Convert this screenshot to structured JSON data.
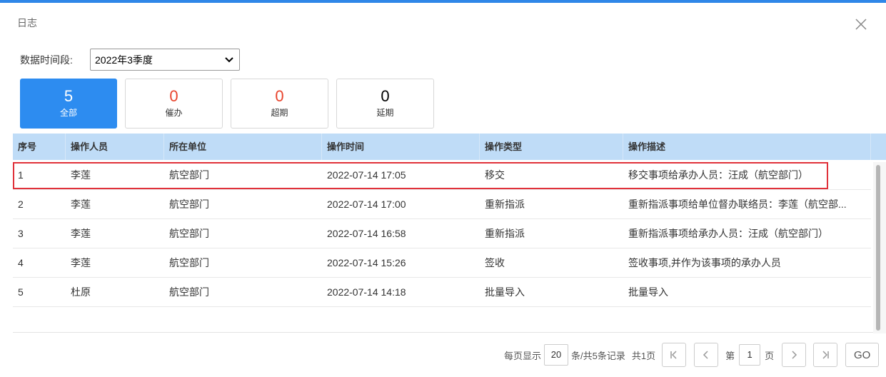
{
  "dialog": {
    "title": "日志"
  },
  "filter": {
    "label": "数据时间段:",
    "selected": "2022年3季度"
  },
  "stats": [
    {
      "count": "5",
      "label": "全部",
      "active": true
    },
    {
      "count": "0",
      "label": "催办",
      "color": "#e8432c"
    },
    {
      "count": "0",
      "label": "超期",
      "color": "#e8432c"
    },
    {
      "count": "0",
      "label": "延期"
    }
  ],
  "table": {
    "columns": [
      "序号",
      "操作人员",
      "所在单位",
      "操作时间",
      "操作类型",
      "操作描述"
    ],
    "rows": [
      [
        "1",
        "李莲",
        "航空部门",
        "2022-07-14 17:05",
        "移交",
        "移交事项给承办人员：汪成（航空部门）"
      ],
      [
        "2",
        "李莲",
        "航空部门",
        "2022-07-14 17:00",
        "重新指派",
        "重新指派事项给单位督办联络员：李莲（航空部..."
      ],
      [
        "3",
        "李莲",
        "航空部门",
        "2022-07-14 16:58",
        "重新指派",
        "重新指派事项给承办人员：汪成（航空部门）"
      ],
      [
        "4",
        "李莲",
        "航空部门",
        "2022-07-14 15:26",
        "签收",
        "签收事项,并作为该事项的承办人员"
      ],
      [
        "5",
        "杜原",
        "航空部门",
        "2022-07-14 14:18",
        "批量导入",
        "批量导入"
      ]
    ],
    "highlight_color": "#e0313a",
    "header_bg": "#bfdcf7"
  },
  "pager": {
    "per_page_label": "每页显示",
    "per_page": "20",
    "records_label": "条/共5条记录",
    "total_pages_label": "共1页",
    "page_prefix": "第",
    "page": "1",
    "page_suffix": "页",
    "go_label": "GO"
  },
  "colors": {
    "accent": "#2d8cf0",
    "top_bar": "#2f87e8",
    "alert": "#e8432c"
  }
}
